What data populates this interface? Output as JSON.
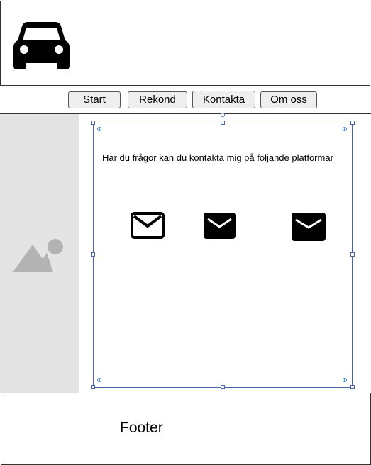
{
  "header": {
    "logo_icon": "car-icon"
  },
  "nav": {
    "items": [
      {
        "label": "Start"
      },
      {
        "label": "Rekond"
      },
      {
        "label": "Kontakta"
      },
      {
        "label": "Om oss"
      }
    ]
  },
  "sidebar": {
    "icon": "image-placeholder-icon"
  },
  "main": {
    "contact_text": "Har du frågor kan du kontakta mig på följande platformar",
    "contact_icons": [
      "mail-outline-icon",
      "mail-icon",
      "mail-icon"
    ]
  },
  "footer": {
    "label": "Footer"
  },
  "colors": {
    "selection": "#4a63b0",
    "sidebar_bg": "#e4e4e4",
    "placeholder_icon": "#b3b3b3"
  }
}
